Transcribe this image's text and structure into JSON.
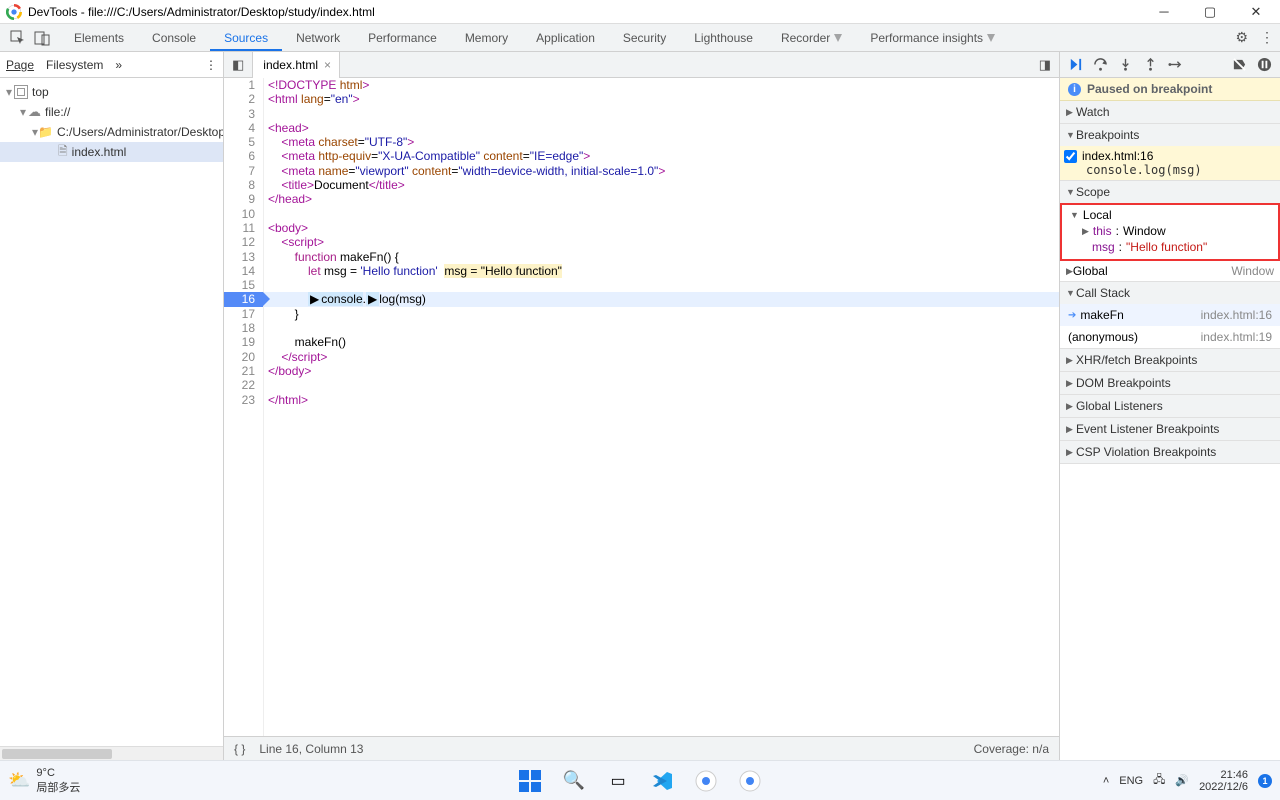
{
  "titlebar": {
    "text": "DevTools - file:///C:/Users/Administrator/Desktop/study/index.html"
  },
  "topmenu": {
    "tabs": [
      "Elements",
      "Console",
      "Sources",
      "Network",
      "Performance",
      "Memory",
      "Application",
      "Security",
      "Lighthouse",
      "Recorder",
      "Performance insights"
    ],
    "active": 2
  },
  "navigator": {
    "panes": [
      "Page",
      "Filesystem"
    ],
    "tree": {
      "root": "top",
      "l1": "file://",
      "l2": "C:/Users/Administrator/Desktop/study",
      "file": "index.html"
    }
  },
  "editor": {
    "tab": "index.html",
    "currentLine": 16,
    "cursor": "Line 16, Column 13",
    "coverage": "Coverage: n/a",
    "overlay": "msg = \"Hello function\""
  },
  "source_lines": [
    {
      "n": 1,
      "html": "<span class='t-tag'>&lt;!DOCTYPE <span class='t-attr'>html</span>&gt;</span>"
    },
    {
      "n": 2,
      "html": "<span class='t-tag'>&lt;html</span> <span class='t-attr'>lang</span>=<span class='t-str'>\"en\"</span><span class='t-tag'>&gt;</span>"
    },
    {
      "n": 3,
      "html": ""
    },
    {
      "n": 4,
      "html": "<span class='t-tag'>&lt;head&gt;</span>"
    },
    {
      "n": 5,
      "html": "    <span class='t-tag'>&lt;meta</span> <span class='t-attr'>charset</span>=<span class='t-str'>\"UTF-8\"</span><span class='t-tag'>&gt;</span>"
    },
    {
      "n": 6,
      "html": "    <span class='t-tag'>&lt;meta</span> <span class='t-attr'>http-equiv</span>=<span class='t-str'>\"X-UA-Compatible\"</span> <span class='t-attr'>content</span>=<span class='t-str'>\"IE=edge\"</span><span class='t-tag'>&gt;</span>"
    },
    {
      "n": 7,
      "html": "    <span class='t-tag'>&lt;meta</span> <span class='t-attr'>name</span>=<span class='t-str'>\"viewport\"</span> <span class='t-attr'>content</span>=<span class='t-str'>\"width=device-width, initial-scale=1.0\"</span><span class='t-tag'>&gt;</span>"
    },
    {
      "n": 8,
      "html": "    <span class='t-tag'>&lt;title&gt;</span>Document<span class='t-tag'>&lt;/title&gt;</span>"
    },
    {
      "n": 9,
      "html": "<span class='t-tag'>&lt;/head&gt;</span>"
    },
    {
      "n": 10,
      "html": ""
    },
    {
      "n": 11,
      "html": "<span class='t-tag'>&lt;body&gt;</span>"
    },
    {
      "n": 12,
      "html": "    <span class='t-tag'>&lt;script&gt;</span>"
    },
    {
      "n": 13,
      "html": "        <span class='t-kw'>function</span> <span class='t-fn'>makeFn</span>() {"
    },
    {
      "n": 14,
      "html": "            <span class='t-kw'>let</span> msg = <span class='t-str'>'Hello function'</span>  <span class='ovr'>msg = \"Hello function\"</span>"
    },
    {
      "n": 15,
      "html": ""
    },
    {
      "n": 16,
      "html": "            <span class='dbg'>▶</span><span style='background:#cfe8fc'>console</span>.<span class='dbg'>▶</span>log(msg)",
      "hl": true
    },
    {
      "n": 17,
      "html": "        }"
    },
    {
      "n": 18,
      "html": ""
    },
    {
      "n": 19,
      "html": "        makeFn()"
    },
    {
      "n": 20,
      "html": "    <span class='t-tag'>&lt;/script&gt;</span>"
    },
    {
      "n": 21,
      "html": "<span class='t-tag'>&lt;/body&gt;</span>"
    },
    {
      "n": 22,
      "html": ""
    },
    {
      "n": 23,
      "html": "<span class='t-tag'>&lt;/html&gt;</span>"
    }
  ],
  "debugger": {
    "banner": "Paused on breakpoint",
    "sections": {
      "watch": "Watch",
      "breakpoints": "Breakpoints",
      "scope": "Scope",
      "callstack": "Call Stack",
      "xhr": "XHR/fetch Breakpoints",
      "dom": "DOM Breakpoints",
      "global": "Global Listeners",
      "event": "Event Listener Breakpoints",
      "csp": "CSP Violation Breakpoints"
    },
    "bp": {
      "loc": "index.html:16",
      "code": "console.log(msg)"
    },
    "scope": {
      "local_label": "Local",
      "this_label": "this",
      "this_val": "Window",
      "msg_label": "msg",
      "msg_val": "\"Hello function\"",
      "global_label": "Global",
      "global_val": "Window"
    },
    "callstack": [
      {
        "fn": "makeFn",
        "loc": "index.html:16",
        "current": true
      },
      {
        "fn": "(anonymous)",
        "loc": "index.html:19",
        "current": false
      }
    ]
  },
  "taskbar": {
    "temp": "9°C",
    "weather": "局部多云",
    "lang": "ENG",
    "time": "21:46",
    "date": "2022/12/6"
  }
}
